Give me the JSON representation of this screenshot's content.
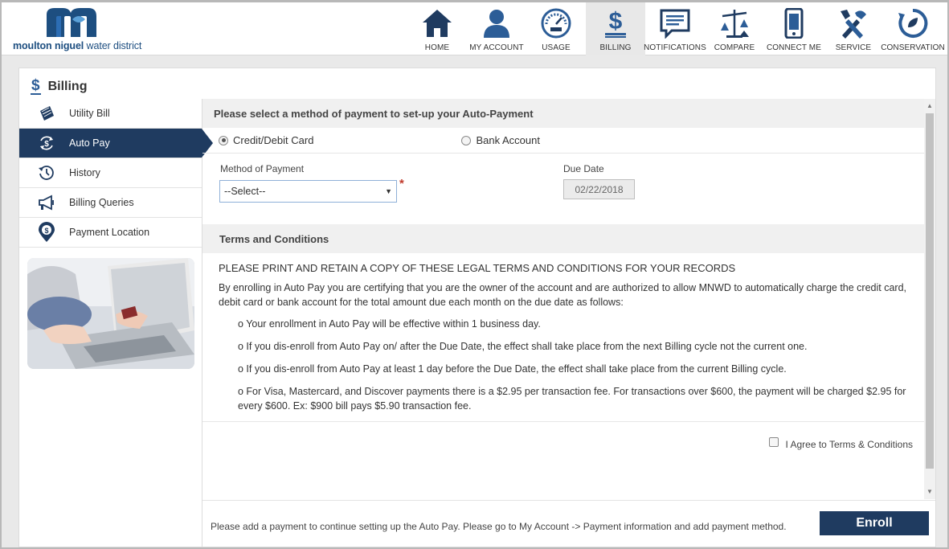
{
  "brand": {
    "name_bold": "moulton niguel",
    "name_rest": " water district",
    "primary_color": "#1d4e80",
    "accent_color": "#1f3b60"
  },
  "nav": {
    "items": [
      {
        "label": "HOME",
        "icon": "home-icon"
      },
      {
        "label": "MY ACCOUNT",
        "icon": "user-icon"
      },
      {
        "label": "USAGE",
        "icon": "gauge-icon"
      },
      {
        "label": "BILLING",
        "icon": "dollar-icon",
        "active": true
      },
      {
        "label": "NOTIFICATIONS",
        "icon": "message-icon"
      },
      {
        "label": "COMPARE",
        "icon": "scale-icon"
      },
      {
        "label": "CONNECT ME",
        "icon": "phone-icon"
      },
      {
        "label": "SERVICE",
        "icon": "tools-icon"
      },
      {
        "label": "CONSERVATION",
        "icon": "recycle-icon"
      }
    ]
  },
  "page": {
    "title": "Billing",
    "title_icon": "$"
  },
  "sidebar": {
    "items": [
      {
        "label": "Utility Bill",
        "icon": "bill-icon"
      },
      {
        "label": "Auto Pay",
        "icon": "autopay-icon",
        "active": true
      },
      {
        "label": "History",
        "icon": "history-icon"
      },
      {
        "label": "Billing Queries",
        "icon": "megaphone-icon"
      },
      {
        "label": "Payment Location",
        "icon": "location-pin-icon"
      }
    ]
  },
  "autopay": {
    "section_title": "Please select a method of payment to set-up your Auto-Payment",
    "options": {
      "card": "Credit/Debit Card",
      "bank": "Bank Account",
      "selected": "card"
    },
    "method_label": "Method of Payment",
    "method_value": "--Select--",
    "required_mark": "*",
    "due_date_label": "Due Date",
    "due_date_value": "02/22/2018"
  },
  "terms": {
    "title": "Terms and Conditions",
    "heading": "PLEASE PRINT AND RETAIN A COPY OF THESE LEGAL TERMS AND CONDITIONS FOR YOUR RECORDS",
    "intro": "By enrolling in Auto Pay you are certifying that you are the owner of the account and are authorized to allow MNWD to automatically charge the credit card, debit card or bank account for the total amount due each month on the due date as follows:",
    "points": [
      "o Your enrollment in Auto Pay will be effective within 1 business day.",
      "o If you dis-enroll from Auto Pay on/ after the Due Date, the effect shall take place from the next Billing cycle not the current one.",
      "o If you dis-enroll from Auto Pay at least 1 day before the Due Date, the effect shall take place from the current Billing cycle.",
      "o For Visa, Mastercard, and Discover payments there is a $2.95 per transaction fee. For transactions over $600, the payment will be charged $2.95 for every $600. Ex: $900 bill pays $5.90 transaction fee."
    ],
    "agree_label": "I Agree to Terms & Conditions"
  },
  "footer": {
    "message": "Please add a payment to continue setting up the Auto Pay. Please go to My Account -> Payment information and add payment method.",
    "enroll_label": "Enroll"
  }
}
